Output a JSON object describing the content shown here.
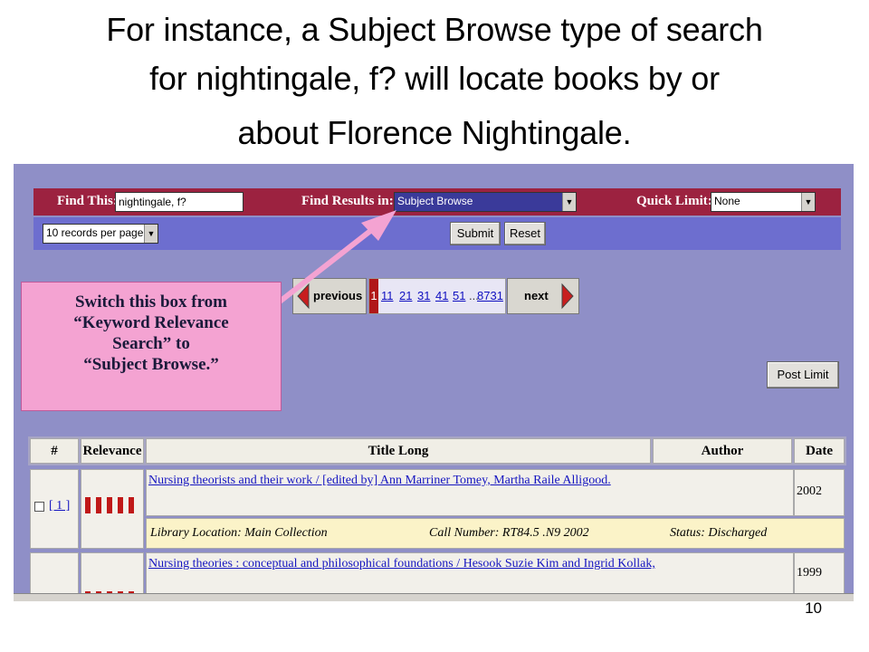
{
  "slide": {
    "title_line1": "For instance, a Subject Browse type of search",
    "title_line2": "for nightingale, f? will locate books by or",
    "title_line3": "about Florence Nightingale.",
    "page_number": "10"
  },
  "search": {
    "find_label": "Find This:",
    "query_value": "nightingale, f?",
    "results_label": "Find Results in:",
    "results_value": "Subject Browse",
    "limit_label": "Quick Limit:",
    "limit_value": "None",
    "per_page_value": "10 records per page",
    "submit_label": "Submit",
    "reset_label": "Reset"
  },
  "pager": {
    "previous_label": "previous",
    "next_label": "next",
    "current": "1",
    "pages": [
      "11",
      "21",
      "31",
      "41",
      "51",
      "...",
      "8731"
    ]
  },
  "post_limit_label": "Post Limit",
  "callout": {
    "line1": "Switch this box from",
    "line2": "“Keyword Relevance",
    "line3": "Search” to",
    "line4": "“Subject Browse.”"
  },
  "table": {
    "headers": [
      "#",
      "Relevance",
      "Title Long",
      "Author",
      "Date"
    ],
    "rows": [
      {
        "num": "[ 1 ]",
        "relevance_bars": 5,
        "title": "Nursing theorists and their work / [edited by] Ann Marriner Tomey, Martha Raile Alligood.",
        "date": "2002",
        "location": "Library Location: Main Collection",
        "call_number": "Call Number: RT84.5 .N9 2002",
        "status": "Status: Discharged"
      },
      {
        "title": "Nursing theories : conceptual and philosophical foundations / Hesook Suzie Kim and Ingrid Kollak,",
        "date": "1999"
      }
    ]
  },
  "colors": {
    "search_bar": "#9c2240",
    "options_bar": "#6d6ecf",
    "page_bg": "#8f8fc7",
    "callout": "#f4a3d2",
    "arrow": "#f4a3d2"
  }
}
